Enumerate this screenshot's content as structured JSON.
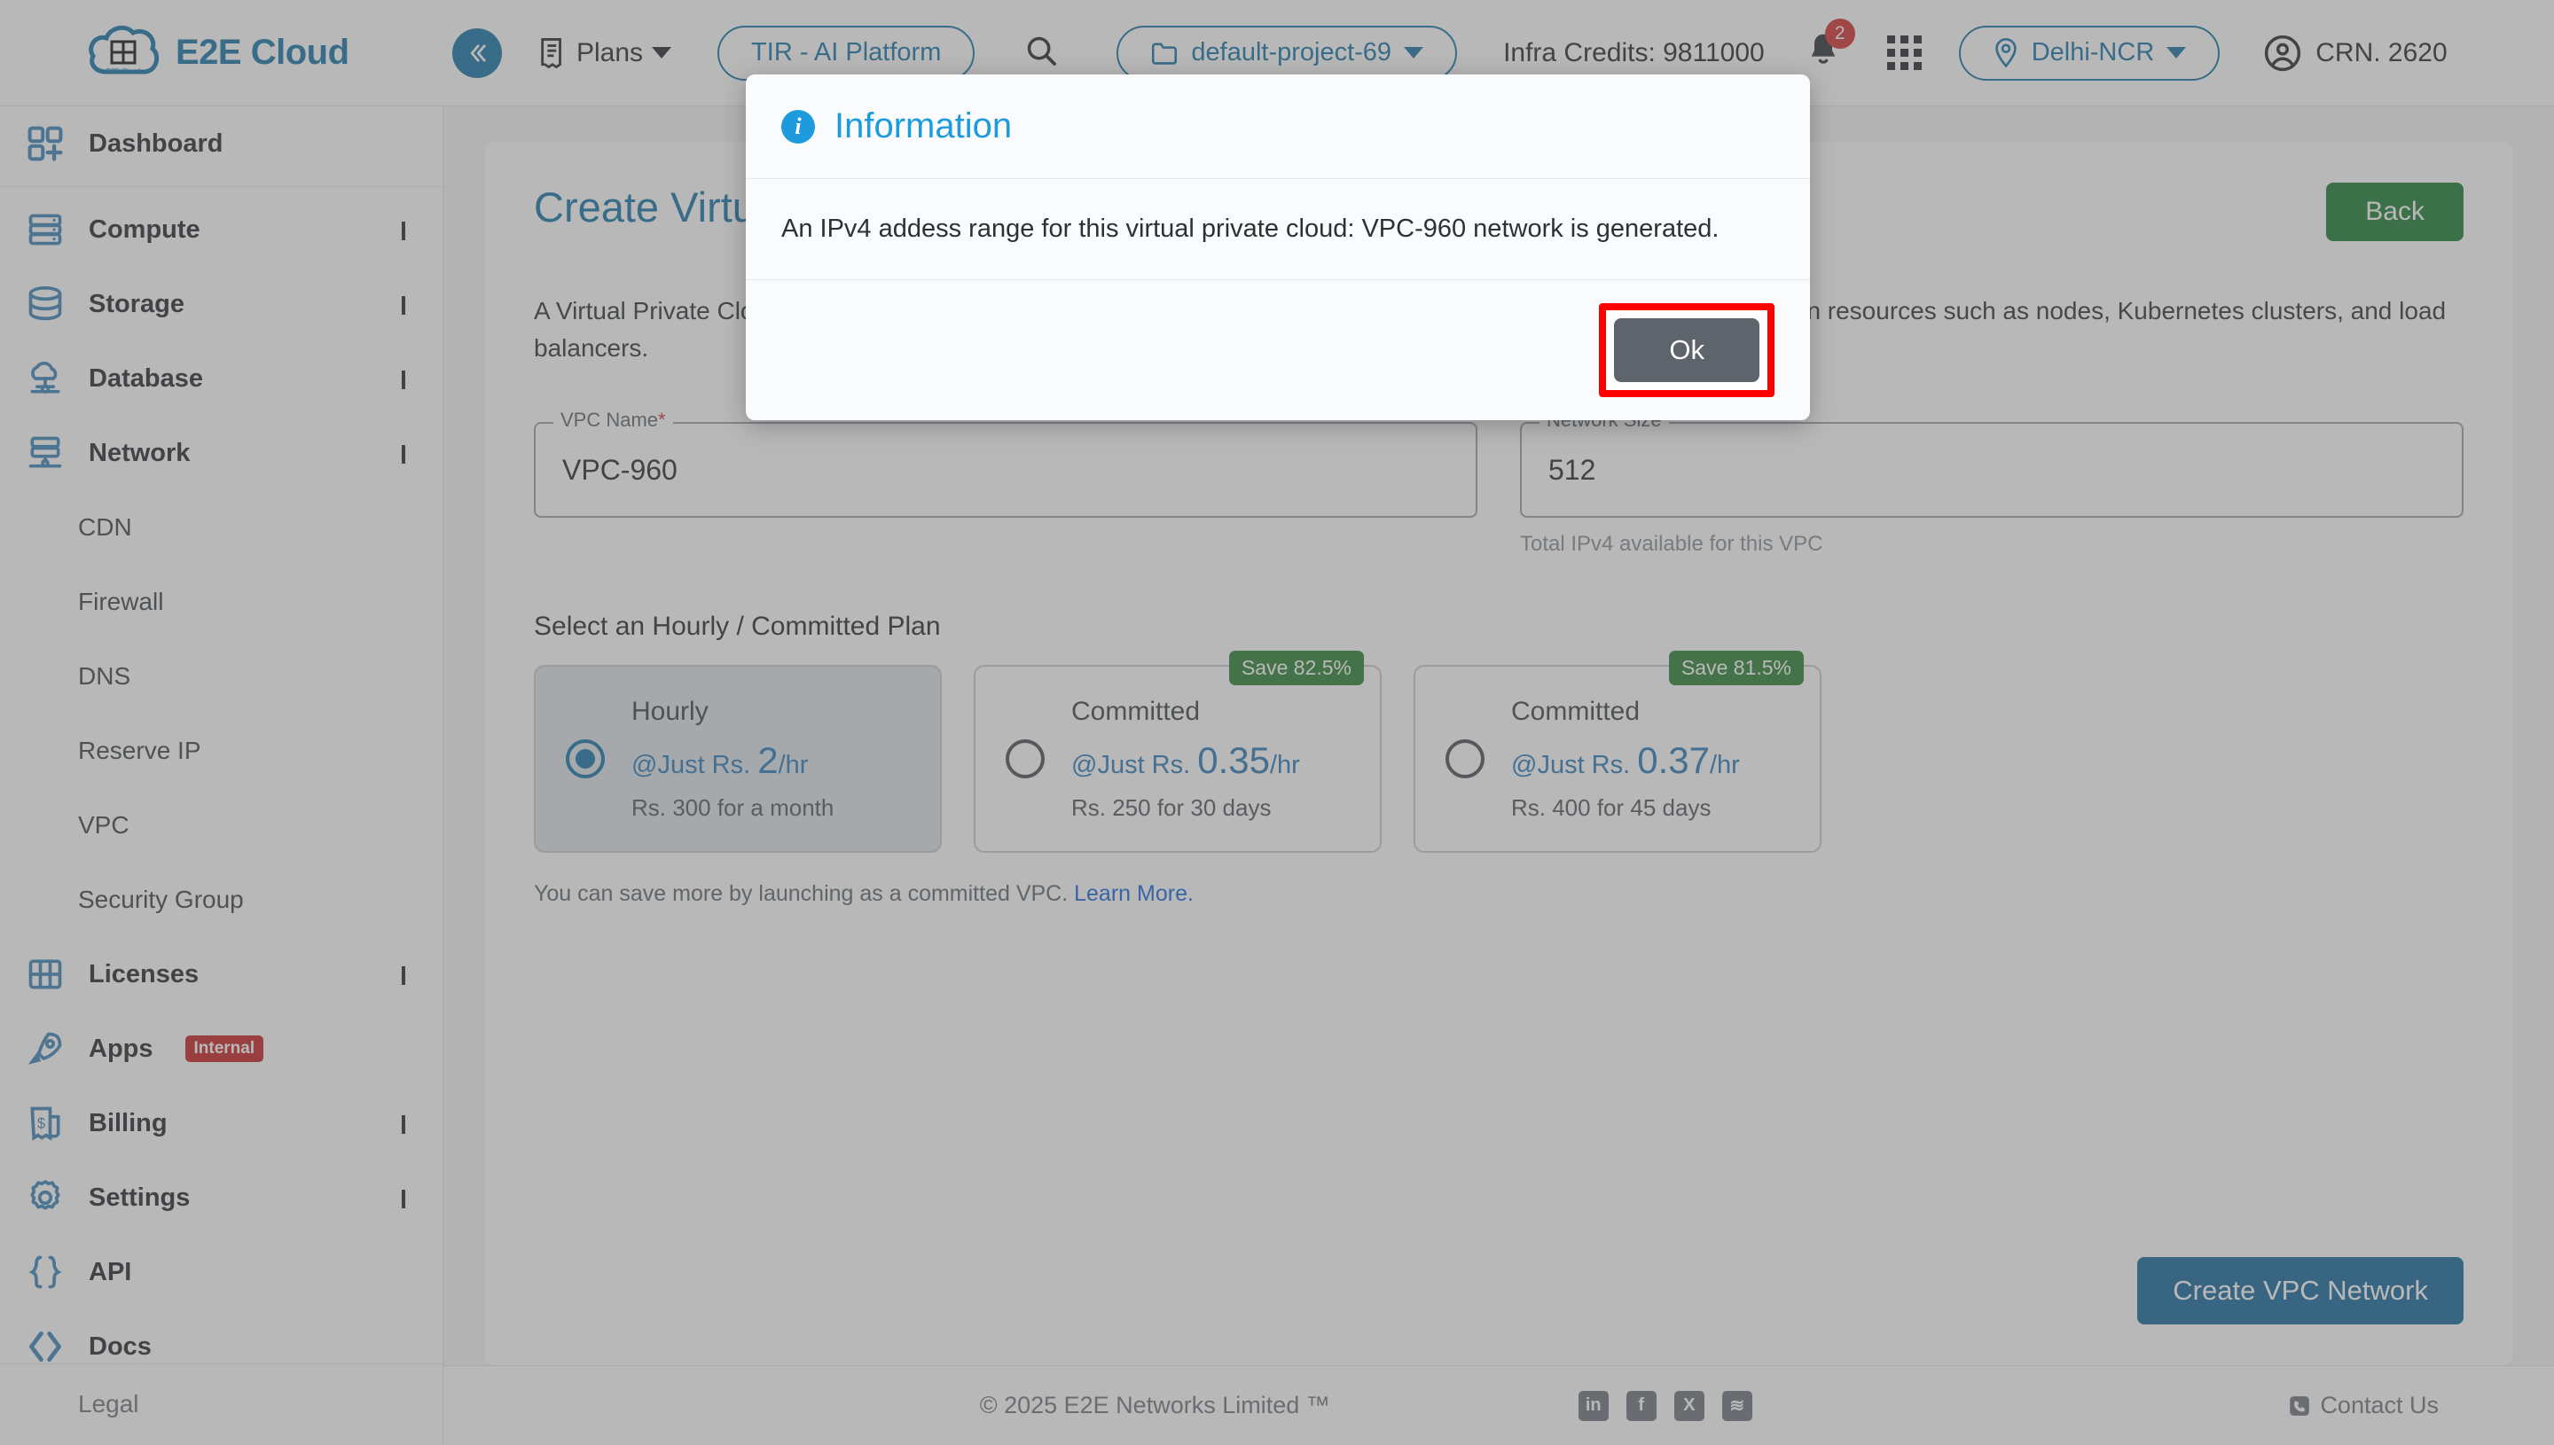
{
  "header": {
    "brand_name": "E2E Cloud",
    "logo_caption": "E2E Cloud",
    "collapse_icon": "double-chevron-left-icon",
    "plans_label": "Plans",
    "tir_label": "TIR - AI Platform",
    "search_icon": "search-icon",
    "project_label": "default-project-69",
    "project_icon": "folder-icon",
    "credits_label": "Infra Credits: 9811000",
    "notification_icon": "bell-icon",
    "notification_count": "2",
    "apps_grid_icon": "grid-apps-icon",
    "region_label": "Delhi-NCR",
    "region_icon": "location-pin-icon",
    "user_label": "CRN. 2620",
    "user_icon": "user-circle-icon"
  },
  "sidebar": {
    "items": [
      {
        "label": "Dashboard",
        "icon": "dashboard-grid-icon",
        "type": "item"
      },
      {
        "label": "Compute",
        "icon": "server-icon",
        "type": "group",
        "expanded": false
      },
      {
        "label": "Storage",
        "icon": "database-stack-icon",
        "type": "group",
        "expanded": false
      },
      {
        "label": "Database",
        "icon": "cloud-database-icon",
        "type": "group",
        "expanded": false
      },
      {
        "label": "Network",
        "icon": "network-icon",
        "type": "group",
        "expanded": true
      },
      {
        "label": "Licenses",
        "icon": "license-grid-icon",
        "type": "group",
        "expanded": false
      },
      {
        "label": "Apps",
        "icon": "rocket-icon",
        "type": "item",
        "badge": "Internal"
      },
      {
        "label": "Billing",
        "icon": "bill-money-icon",
        "type": "group",
        "expanded": false
      },
      {
        "label": "Settings",
        "icon": "gear-icon",
        "type": "group",
        "expanded": false
      },
      {
        "label": "API",
        "icon": "braces-icon",
        "type": "item"
      },
      {
        "label": "Docs",
        "icon": "code-angle-icon",
        "type": "item"
      }
    ],
    "network_children": [
      "CDN",
      "Firewall",
      "DNS",
      "Reserve IP",
      "VPC",
      "Security Group"
    ],
    "footer_label": "Legal"
  },
  "main": {
    "page_title": "Create Virtual Private Cloud",
    "back_label": "Back",
    "description": "A Virtual Private Cloud (VPC) is an isolated private network that lets you securely and privately secure traffic between resources such as nodes, Kubernetes clusters, and load balancers.",
    "vpc_name_legend": "VPC Name",
    "vpc_name_required": "*",
    "vpc_name_value": "VPC-960",
    "network_size_legend": "Network Size",
    "network_size_value": "512",
    "network_size_hint": "Total IPv4 available for this VPC",
    "plans_title": "Select an Hourly / Committed Plan",
    "plans": [
      {
        "name": "Hourly",
        "price_prefix": "@Just Rs. ",
        "price_value": "2",
        "price_suffix": "/hr",
        "sub": "Rs. 300 for a month",
        "selected": true,
        "save_badge": ""
      },
      {
        "name": "Committed",
        "price_prefix": "@Just Rs. ",
        "price_value": "0.35",
        "price_suffix": "/hr",
        "sub": "Rs. 250 for 30 days",
        "selected": false,
        "save_badge": "Save 82.5%"
      },
      {
        "name": "Committed",
        "price_prefix": "@Just Rs. ",
        "price_value": "0.37",
        "price_suffix": "/hr",
        "sub": "Rs. 400 for 45 days",
        "selected": false,
        "save_badge": "Save 81.5%"
      }
    ],
    "save_note_text": "You can save more by launching as a committed VPC. ",
    "save_note_link": "Learn More.",
    "create_button": "Create VPC Network"
  },
  "modal": {
    "icon": "info-icon",
    "title": "Information",
    "message": "An IPv4 addess range for this virtual private cloud: VPC-960 network is generated.",
    "ok_label": "Ok",
    "highlight_color": "#ff0000"
  },
  "footer": {
    "copyright": "© 2025 E2E Networks Limited ™",
    "socials": [
      "in",
      "f",
      "X",
      "≋"
    ],
    "contact_label": "Contact Us",
    "contact_icon": "phone-icon"
  },
  "colors": {
    "brand": "#1574a6",
    "accent_green": "#1b7a30",
    "save_green": "#2c8032",
    "danger": "#c62020",
    "info": "#1e9bdc"
  }
}
